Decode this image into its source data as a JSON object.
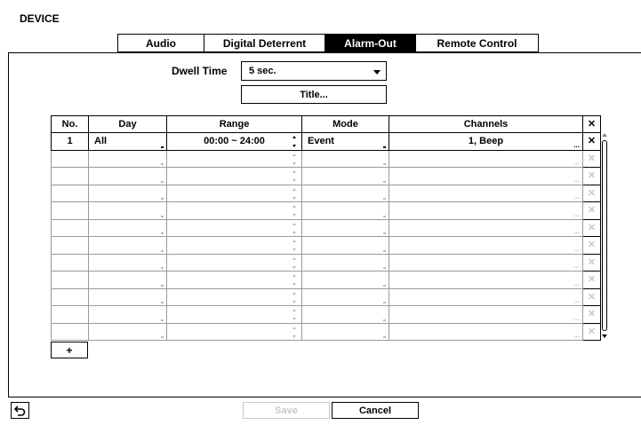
{
  "window": {
    "title": "DEVICE"
  },
  "tabs": [
    {
      "label": "Audio",
      "active": false
    },
    {
      "label": "Digital Deterrent",
      "active": false
    },
    {
      "label": "Alarm-Out",
      "active": true
    },
    {
      "label": "Remote Control",
      "active": false
    }
  ],
  "dwell": {
    "label": "Dwell Time",
    "value": "5 sec.",
    "icon": "chevron-down-icon"
  },
  "title_button": {
    "label": "Title..."
  },
  "table": {
    "headers": {
      "no": "No.",
      "day": "Day",
      "range": "Range",
      "mode": "Mode",
      "channels": "Channels",
      "delete_all": "✕"
    },
    "rows": [
      {
        "no": "1",
        "day": "All",
        "range": "00:00 ~ 24:00",
        "mode": "Event",
        "channels": "1, Beep",
        "delete": "✕"
      },
      {
        "no": "",
        "day": "",
        "range": "",
        "mode": "",
        "channels": "",
        "delete": "✕"
      },
      {
        "no": "",
        "day": "",
        "range": "",
        "mode": "",
        "channels": "",
        "delete": "✕"
      },
      {
        "no": "",
        "day": "",
        "range": "",
        "mode": "",
        "channels": "",
        "delete": "✕"
      },
      {
        "no": "",
        "day": "",
        "range": "",
        "mode": "",
        "channels": "",
        "delete": "✕"
      },
      {
        "no": "",
        "day": "",
        "range": "",
        "mode": "",
        "channels": "",
        "delete": "✕"
      },
      {
        "no": "",
        "day": "",
        "range": "",
        "mode": "",
        "channels": "",
        "delete": "✕"
      },
      {
        "no": "",
        "day": "",
        "range": "",
        "mode": "",
        "channels": "",
        "delete": "✕"
      },
      {
        "no": "",
        "day": "",
        "range": "",
        "mode": "",
        "channels": "",
        "delete": "✕"
      },
      {
        "no": "",
        "day": "",
        "range": "",
        "mode": "",
        "channels": "",
        "delete": "✕"
      },
      {
        "no": "",
        "day": "",
        "range": "",
        "mode": "",
        "channels": "",
        "delete": "✕"
      },
      {
        "no": "",
        "day": "",
        "range": "",
        "mode": "",
        "channels": "",
        "delete": "✕"
      }
    ]
  },
  "add_button": {
    "label": "+"
  },
  "footer": {
    "back_icon": "back-arrow-icon",
    "save_label": "Save",
    "save_enabled": false,
    "cancel_label": "Cancel"
  },
  "colors": {
    "active_tab_bg": "#000000",
    "disabled_text": "#c8c8c8"
  }
}
